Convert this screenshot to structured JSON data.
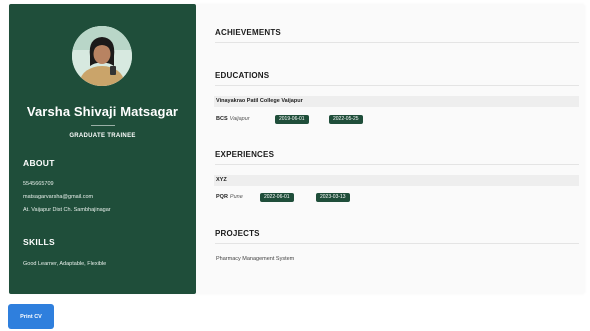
{
  "profile": {
    "name": "Varsha Shivaji Matsagar",
    "title": "GRADUATE TRAINEE"
  },
  "about": {
    "heading": "ABOUT",
    "phone": "5545665709",
    "email": "matsagarvarsha@gmail.com",
    "address": "At. Vaijapur Dist Ch. Sambhajinagar"
  },
  "skills": {
    "heading": "SKILLS",
    "text": "Good Learner, Adaptable, Flexible"
  },
  "sections": {
    "achievements": "ACHIEVEMENTS",
    "educations": "EDUCATIONS",
    "experiences": "EXPERIENCES",
    "projects": "PROJECTS"
  },
  "education": {
    "institution": "Vinayakrao Patil College Vaijapur",
    "degree": "BCS",
    "location": "Vaijapur",
    "start": "2019-06-01",
    "end": "2022-05-25"
  },
  "experience": {
    "company": "XYZ",
    "role": "PQR",
    "location": "Pune",
    "start": "2022-06-01",
    "end": "2023-03-13"
  },
  "project": {
    "name": "Pharmacy Management System"
  },
  "actions": {
    "print_label": "Print CV"
  },
  "colors": {
    "sidebar": "#1f4e3a",
    "pill": "#1f4e3a",
    "button": "#2f7fdd"
  }
}
